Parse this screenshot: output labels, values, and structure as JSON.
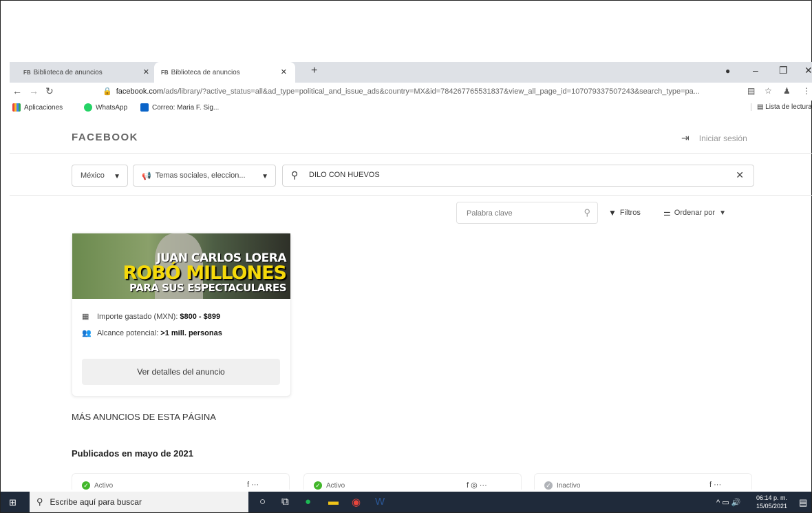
{
  "browser": {
    "tabs": [
      {
        "favicon": "FB",
        "label": "Biblioteca de anuncios",
        "active": false
      },
      {
        "favicon": "FB",
        "label": "Biblioteca de anuncios",
        "active": true
      }
    ],
    "url_host": "facebook.com",
    "url_path": "/ads/library/?active_status=all&ad_type=political_and_issue_ads&country=MX&id=784267765531837&view_all_page_id=107079337507243&search_type=pa...",
    "bookmarks": [
      {
        "label": "Aplicaciones",
        "icon": "apps-grid-icon"
      },
      {
        "label": "WhatsApp",
        "icon": "whatsapp-icon"
      },
      {
        "label": "Correo: Maria F. Sig...",
        "icon": "outlook-icon"
      }
    ],
    "reading_list": "Lista de lectura"
  },
  "header": {
    "logo": "FACEBOOK",
    "login": "Iniciar sesión"
  },
  "filters": {
    "country": "México",
    "ad_category": "Temas sociales, eleccion...",
    "search_value": "DILO CON HUEVOS",
    "keyword_placeholder": "Palabra clave",
    "filters_label": "Filtros",
    "sort_label": "Ordenar por"
  },
  "ad": {
    "image_text": {
      "line1": "JUAN CARLOS LOERA",
      "line2": "ROBÓ MILLONES",
      "line3": "PARA SUS ESPECTACULARES"
    },
    "spend_label": "Importe gastado (MXN):",
    "spend_value": "$800 - $899",
    "reach_label": "Alcance potencial:",
    "reach_value": ">1 mill. personas",
    "details_button": "Ver detalles del anuncio"
  },
  "more_ads": {
    "section_title": "MÁS ANUNCIOS DE ESTA PÁGINA",
    "month_title": "Publicados en mayo de 2021",
    "cards": [
      {
        "status": "Activo",
        "status_color": "#42b72a",
        "platforms": "f ···"
      },
      {
        "status": "Activo",
        "status_color": "#42b72a",
        "platforms": "f ◎ ···"
      },
      {
        "status": "Inactivo",
        "status_color": "#b0b3b8",
        "platforms": "f ···"
      }
    ]
  },
  "taskbar": {
    "search_placeholder": "Escribe aquí para buscar",
    "time": "06:14 p. m.",
    "date": "15/05/2021"
  },
  "colors": {
    "taskbar": "#1f2a3a",
    "tabbar": "#dee1e6",
    "ad_yellow": "#f5d90a"
  }
}
